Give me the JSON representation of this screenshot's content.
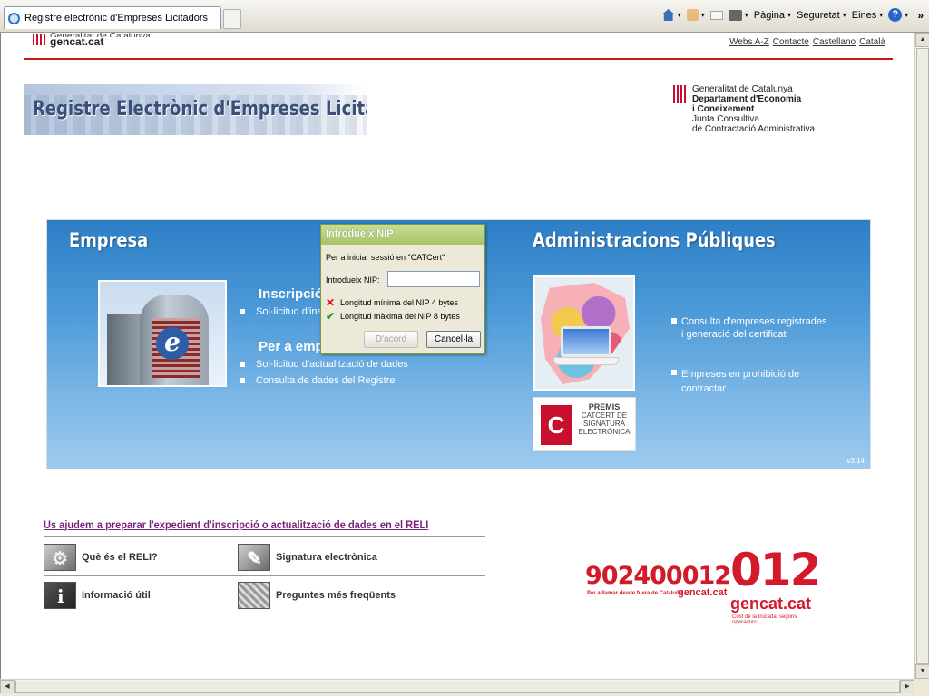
{
  "browser": {
    "tab_title": "Registre electrònic d'Empreses Licitadors",
    "cmd_page": "Pàgina",
    "cmd_security": "Seguretat",
    "cmd_tools": "Eines"
  },
  "header": {
    "logo_line1": "Generalitat de Catalunya",
    "logo_line2": "gencat.cat",
    "links": [
      "Webs A-Z",
      "Contacte",
      "Castellano",
      "Català"
    ],
    "banner_title": "Registre Electrònic d'Empreses Licitadores",
    "dept": [
      "Generalitat de Catalunya",
      "Departament d'Economia",
      "i Coneixement",
      "Junta Consultiva",
      "de Contractació Administrativa"
    ]
  },
  "panel": {
    "empresa_title": "Empresa",
    "inscripcio_title": "Inscripció",
    "inscripcio_item": "Sol·licitud d'ins",
    "per_empresa_title": "Per a emp",
    "per_empresa_items": [
      "Sol·licitud d'actualització de dades",
      "Consulta de dades del Registre"
    ],
    "admin_title": "Administracions Públiques",
    "admin_items": [
      [
        "Consulta d'empreses registrades",
        "i generació del certificat"
      ],
      [
        "Empreses en prohibició de",
        "contractar"
      ]
    ],
    "premis": [
      "PREMIS",
      "CATCERT DE",
      "SIGNATURA",
      "ELECTRÒNICA"
    ],
    "version": "v3.14"
  },
  "dialog": {
    "title": "Introdueix NIP",
    "message": "Per a iniciar sessió en \"CATCert\"",
    "label": "Introdueix NIP:",
    "nip_value": "",
    "rule_min": "Longitud mínima del NIP 4 bytes",
    "rule_max": "Longitud màxima del NIP 8 bytes",
    "ok_label": "D'acord",
    "cancel_label": "Cancel·la"
  },
  "bottom": {
    "help_link": "Us ajudem a preparar l'expedient d'inscripció o actualització de dades en el RELI",
    "items": [
      "Què és el RELI?",
      "Signatura electrònica",
      "Informació útil",
      "Preguntes més freqüents"
    ]
  },
  "contact": {
    "phone": "902400012",
    "phone_sub": "Per a llamar desde fuera de Cataluña",
    "gencat": "gencat.cat",
    "big": "012",
    "cost": "Cost de la trucada: segons operadors"
  },
  "colors": {
    "accent_red": "#c41818",
    "panel_blue": "#4a98d7",
    "dialog_green": "#a7c265"
  }
}
